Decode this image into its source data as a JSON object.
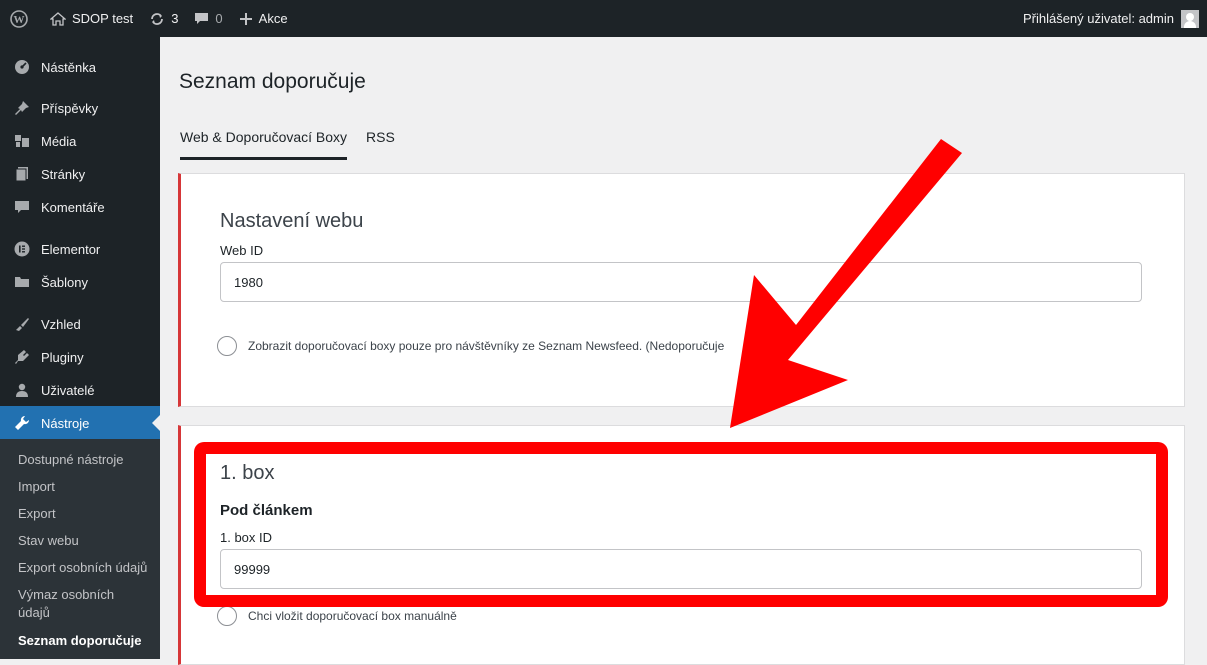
{
  "adminbar": {
    "site_name": "SDOP test",
    "updates_count": "3",
    "comments_count": "0",
    "new_label": "Akce",
    "account_label": "Přihlášený uživatel: admin"
  },
  "sidebar": {
    "items": [
      {
        "label": "Nástěnka",
        "icon": "dashboard-icon"
      },
      {
        "label": "Příspěvky",
        "icon": "pin-icon"
      },
      {
        "label": "Média",
        "icon": "media-icon"
      },
      {
        "label": "Stránky",
        "icon": "pages-icon"
      },
      {
        "label": "Komentáře",
        "icon": "comments-icon"
      },
      {
        "label": "Elementor",
        "icon": "elementor-icon"
      },
      {
        "label": "Šablony",
        "icon": "folder-icon"
      },
      {
        "label": "Vzhled",
        "icon": "appearance-icon"
      },
      {
        "label": "Pluginy",
        "icon": "plugins-icon"
      },
      {
        "label": "Uživatelé",
        "icon": "users-icon"
      },
      {
        "label": "Nástroje",
        "icon": "wrench-icon"
      }
    ],
    "submenu": [
      "Dostupné nástroje",
      "Import",
      "Export",
      "Stav webu",
      "Export osobních údajů",
      "Výmaz osobních údajů",
      "Seznam doporučuje"
    ]
  },
  "main": {
    "title": "Seznam doporučuje",
    "tabs": [
      "Web & Doporučovací Boxy",
      "RSS"
    ],
    "web_settings": {
      "heading": "Nastavení webu",
      "web_id_label": "Web ID",
      "web_id_value": "1980",
      "checkbox_label": "Zobrazit doporučovací boxy pouze pro návštěvníky ze Seznam Newsfeed. (Nedoporučuje"
    },
    "box1": {
      "heading": "1. box",
      "subheading": "Pod článkem",
      "id_label": "1. box ID",
      "id_value": "99999",
      "manual_label": "Chci vložit doporučovací box manuálně"
    }
  },
  "colors": {
    "admin_bar_bg": "#1d2327",
    "active_menu": "#2271b1",
    "card_accent": "#d63638",
    "highlight": "#ff0000"
  }
}
